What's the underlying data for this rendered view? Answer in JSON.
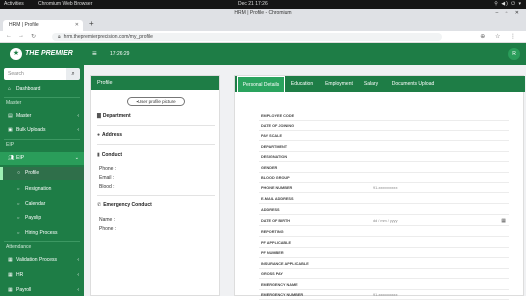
{
  "system_bar": {
    "activities": "Activities",
    "app": "Chromium Web Browser",
    "clock": "Dec 21  17:26"
  },
  "window": {
    "title": "HRM | Profile - Chromium"
  },
  "browser": {
    "tab_title": "HRM | Profile",
    "url": "hrm.thepremierprecision.com/my_profile"
  },
  "header": {
    "brand": "THE PREMIER",
    "time": "17:26:29",
    "avatar": "R"
  },
  "sidebar": {
    "search_placeholder": "Search",
    "dashboard": "Dashboard",
    "master_heading": "Master",
    "master": "Master",
    "bulk_uploads": "Bulk Uploads",
    "eip_heading": "EIP",
    "eip": "EIP",
    "profile": "Profile",
    "resignation": "Resignation",
    "calendar": "Calendar",
    "payslip": "Payslip",
    "hiring_process": "Hiring Process",
    "attendance_heading": "Attendance",
    "validation_process": "Validation Process",
    "hr": "HR",
    "payroll": "Payroll"
  },
  "profile_card": {
    "title": "Profile",
    "picture_button": "User profile picture",
    "department": "Department",
    "address": "Address",
    "conduct": "Conduct",
    "phone": "Phone :",
    "email": "Email :",
    "blood": "Blood :",
    "emergency_conduct": "Emergency Conduct",
    "name": "Name :",
    "emergency_phone": "Phone :"
  },
  "details": {
    "tabs": [
      "Personal Details",
      "Education",
      "Employment",
      "Salary",
      "Documents Upload"
    ],
    "rows": [
      {
        "label": "EMPLOYEE CODE",
        "value": ""
      },
      {
        "label": "DATE OF JOINING",
        "value": ""
      },
      {
        "label": "PAY SCALE",
        "value": ""
      },
      {
        "label": "DEPARTMENT",
        "value": ""
      },
      {
        "label": "DESIGNATION",
        "value": ""
      },
      {
        "label": "GENDER",
        "value": ""
      },
      {
        "label": "BLOOD GROUP",
        "value": ""
      },
      {
        "label": "PHONE NUMBER",
        "value": "91-xxxxxxxxxx"
      },
      {
        "label": "E-MAIL ADDRESS",
        "value": ""
      },
      {
        "label": "ADDRESS",
        "value": ""
      },
      {
        "label": "DATE OF BIRTH",
        "value": "dd / mm / yyyy"
      },
      {
        "label": "REPORTING",
        "value": ""
      },
      {
        "label": "PF APPLICABLE",
        "value": ""
      },
      {
        "label": "PF NUMBER",
        "value": ""
      },
      {
        "label": "INSURANCE APPLICABLE",
        "value": ""
      },
      {
        "label": "GROSS PAY",
        "value": ""
      },
      {
        "label": "EMERGENCY NAME",
        "value": ""
      },
      {
        "label": "EMERGENCY NUMBER",
        "value": "91-xxxxxxxxxx"
      }
    ]
  }
}
